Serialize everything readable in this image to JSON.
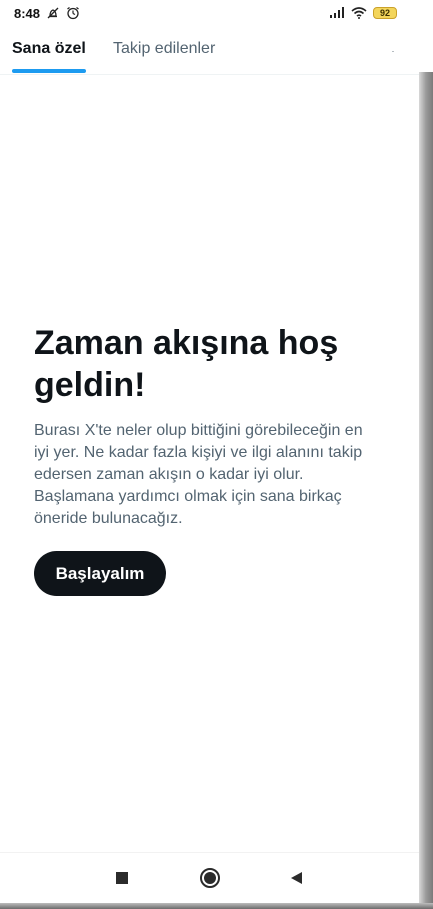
{
  "status_bar": {
    "time": "8:48",
    "battery": "92",
    "icons": [
      "do-not-disturb-icon",
      "alarm-icon",
      "signal-icon",
      "wifi-icon",
      "battery-icon"
    ]
  },
  "tabs": [
    {
      "label": "Sana özel",
      "active": true
    },
    {
      "label": "Takip edilenler",
      "active": false
    }
  ],
  "welcome": {
    "title": "Zaman akışına hoş geldin!",
    "body": "Burası X'te neler olup bittiğini görebileceğin en iyi yer. Ne kadar fazla kişiyi ve ilgi alanını takip edersen zaman akışın o kadar iyi olur. Başlamana yardımcı olmak için sana birkaç öneride bulunacağız.",
    "button_label": "Başlayalım"
  },
  "nav_bar": {
    "icons": [
      "recents-icon",
      "home-icon",
      "back-icon"
    ]
  },
  "colors": {
    "accent": "#1d9bf0",
    "text_primary": "#0f1419",
    "text_secondary": "#536471",
    "button_bg": "#0f1419",
    "battery": "#f3d55b"
  }
}
